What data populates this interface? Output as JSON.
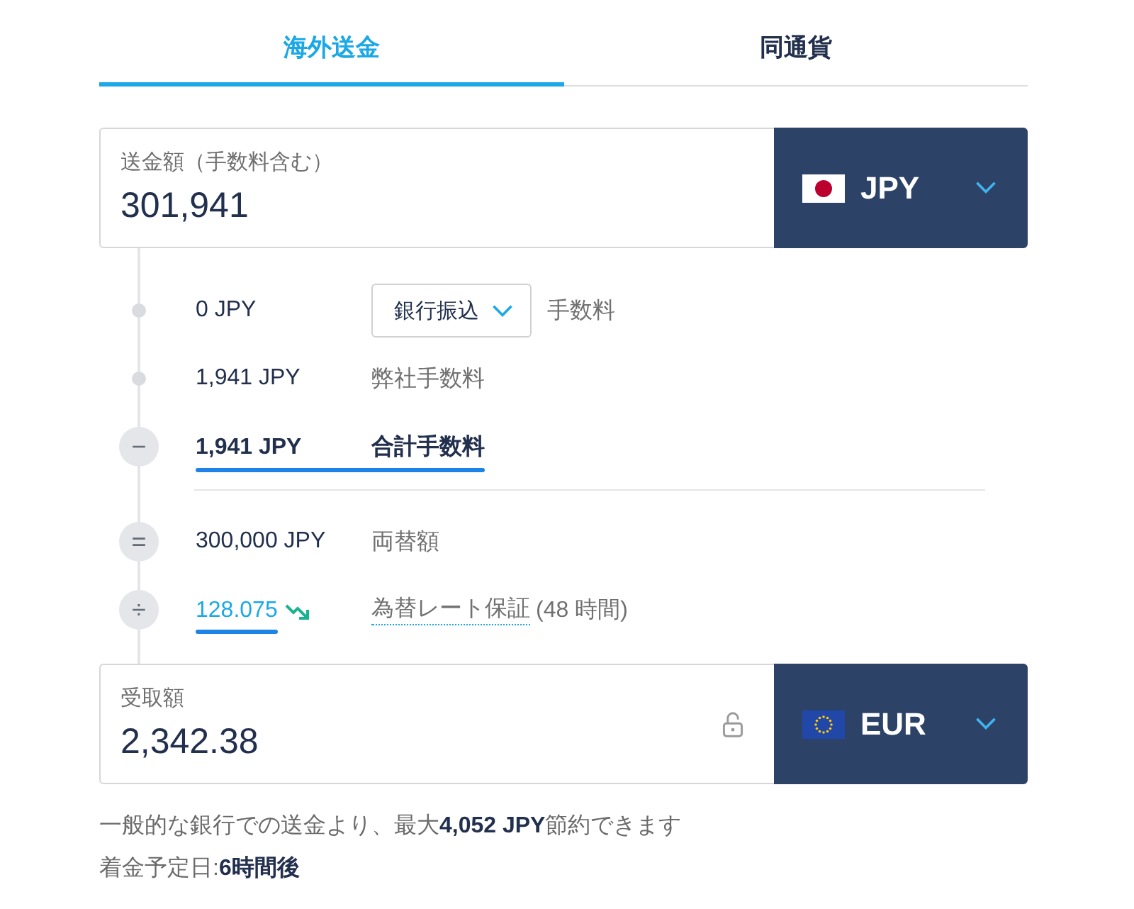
{
  "tabs": [
    {
      "label": "海外送金",
      "selected": true
    },
    {
      "label": "同通貨",
      "selected": false
    }
  ],
  "send": {
    "label": "送金額（手数料含む）",
    "value": "301,941",
    "currency": "JPY",
    "flag": {
      "kind": "japan"
    }
  },
  "steps": [
    {
      "kind": "method",
      "amount": "0 JPY",
      "method": "銀行振込",
      "label": "手数料",
      "rule_below": false
    },
    {
      "kind": "plain",
      "amount": "1,941 JPY",
      "label": "弊社手数料",
      "rule_below": false
    },
    {
      "kind": "total",
      "symbol": "−",
      "amount": "1,941 JPY",
      "label": "合計手数料",
      "rule_below": true
    },
    {
      "kind": "plain",
      "symbol": "=",
      "amount": "300,000 JPY",
      "label": "両替額",
      "rule_below": false
    },
    {
      "kind": "rate",
      "symbol": "÷",
      "amount": "128.075",
      "falling": true,
      "label": "為替レート保証",
      "note": "(48 時間)",
      "rule_below": false
    }
  ],
  "receive": {
    "label": "受取額",
    "value": "2,342.38",
    "locked": false,
    "currency": "EUR",
    "flag": {
      "kind": "eu"
    }
  },
  "savings_note": "一般的な銀行での送金より、最大**4,052 JPY**節約できます",
  "arrival_note": "着金予定日:**6時間後**"
}
